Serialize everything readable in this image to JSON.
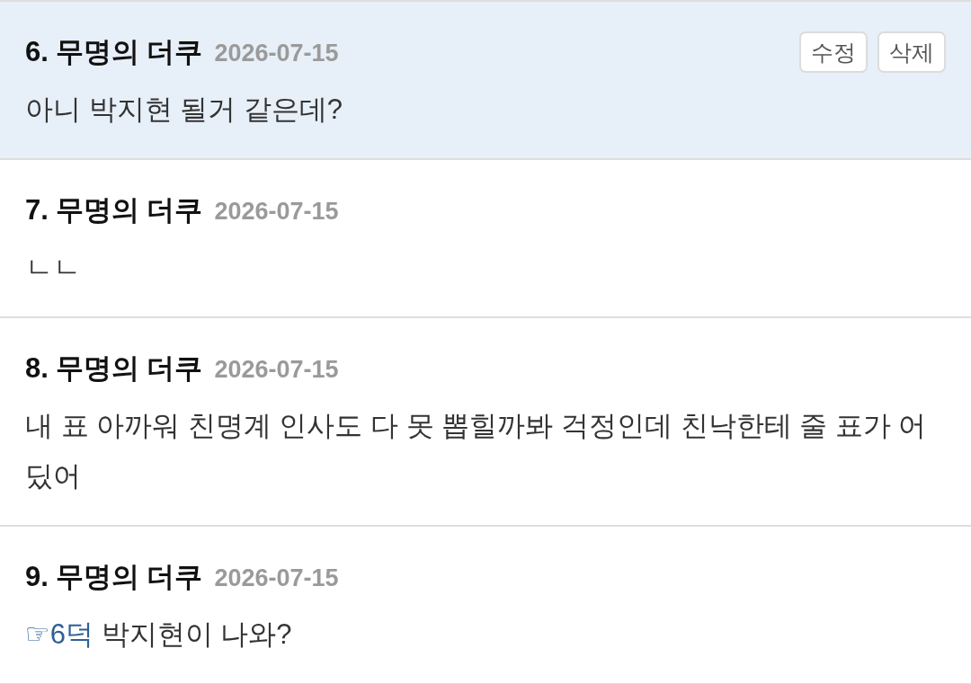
{
  "comments": [
    {
      "number": "6.",
      "author": "무명의 더쿠",
      "date": "2026-07-15",
      "highlighted": true,
      "actions": [
        "수정",
        "삭제"
      ],
      "text": "아니 박지현 될거 같은데?"
    },
    {
      "number": "7.",
      "author": "무명의 더쿠",
      "date": "2026-07-15",
      "highlighted": false,
      "text": "ㄴㄴ"
    },
    {
      "number": "8.",
      "author": "무명의 더쿠",
      "date": "2026-07-15",
      "highlighted": false,
      "text": "내 표 아까워 친명계 인사도 다 못 뽑힐까봐 걱정인데 친낙한테 줄 표가 어딨어"
    },
    {
      "number": "9.",
      "author": "무명의 더쿠",
      "date": "2026-07-15",
      "highlighted": false,
      "reply_link": "☞6덕",
      "text": "박지현이 나와?"
    }
  ]
}
